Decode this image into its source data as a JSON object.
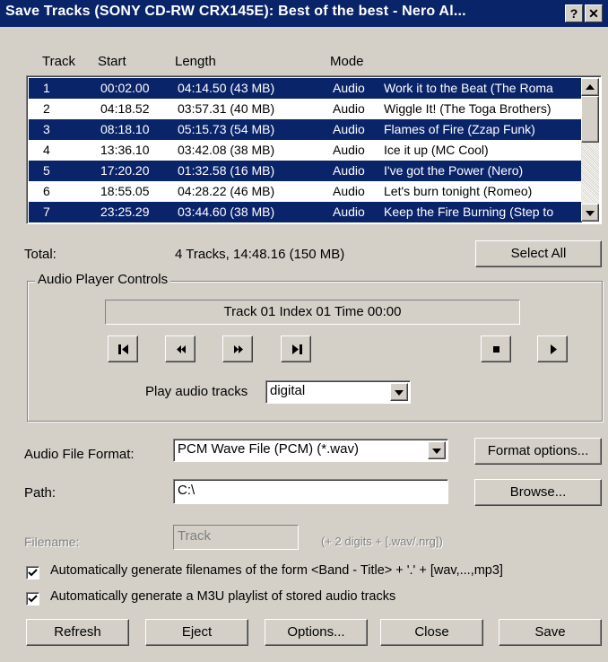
{
  "window": {
    "title": "Save Tracks (SONY     CD-RW  CRX145E):  Best of the best - Nero Al...",
    "help_glyph": "?",
    "close_glyph": "✕"
  },
  "tracklist": {
    "columns": [
      "Track",
      "Start",
      "Length",
      "Mode"
    ],
    "rows": [
      {
        "track": "1",
        "start": "00:02.00",
        "length": "04:14.50 (43 MB)",
        "mode": "Audio",
        "title": "Work it to the Beat (The Roma",
        "selected": true
      },
      {
        "track": "2",
        "start": "04:18.52",
        "length": "03:57.31 (40 MB)",
        "mode": "Audio",
        "title": "Wiggle It! (The Toga Brothers)",
        "selected": false
      },
      {
        "track": "3",
        "start": "08:18.10",
        "length": "05:15.73 (54 MB)",
        "mode": "Audio",
        "title": "Flames of Fire (Zzap Funk)",
        "selected": true
      },
      {
        "track": "4",
        "start": "13:36.10",
        "length": "03:42.08 (38 MB)",
        "mode": "Audio",
        "title": "Ice it up (MC Cool)",
        "selected": false
      },
      {
        "track": "5",
        "start": "17:20.20",
        "length": "01:32.58 (16 MB)",
        "mode": "Audio",
        "title": "I've got the Power (Nero)",
        "selected": true
      },
      {
        "track": "6",
        "start": "18:55.05",
        "length": "04:28.22 (46 MB)",
        "mode": "Audio",
        "title": "Let's burn tonight (Romeo)",
        "selected": false
      },
      {
        "track": "7",
        "start": "23:25.29",
        "length": "03:44.60 (38 MB)",
        "mode": "Audio",
        "title": "Keep the Fire Burning (Step to",
        "selected": true
      }
    ]
  },
  "total": {
    "label": "Total:",
    "value": "4 Tracks, 14:48.16 (150 MB)",
    "select_all": "Select All"
  },
  "player": {
    "group_title": "Audio Player Controls",
    "status": "Track 01 Index 01 Time 00:00",
    "play_audio_label": "Play audio tracks",
    "play_audio_value": "digital"
  },
  "format": {
    "label": "Audio File Format:",
    "value": "PCM Wave File (PCM) (*.wav)",
    "options_button": "Format options..."
  },
  "path": {
    "label": "Path:",
    "value": "C:\\",
    "browse_button": "Browse..."
  },
  "filename": {
    "label": "Filename:",
    "value": "Track",
    "hint": "(+ 2 digits + [.wav/.nrg])"
  },
  "checkboxes": {
    "auto_filenames": "Automatically generate filenames of the form <Band - Title> + '.' + [wav,...,mp3]",
    "auto_m3u": "Automatically generate a M3U playlist of stored audio tracks"
  },
  "buttons": {
    "refresh": "Refresh",
    "eject": "Eject",
    "options": "Options...",
    "close": "Close",
    "save": "Save"
  },
  "colors": {
    "selection": "#0a246a",
    "face": "#d4d0c8"
  }
}
